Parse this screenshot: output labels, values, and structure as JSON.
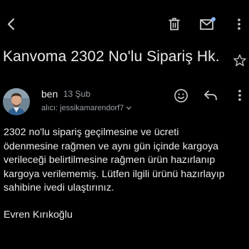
{
  "toolbar": {
    "icons": [
      "back-arrow-icon",
      "trash-icon",
      "mark-unread-icon",
      "more-vert-icon"
    ]
  },
  "email": {
    "subject": "Kanvoma 2302 No'lu Sipariş Hk.",
    "sender_name": "ben",
    "date": "13 Şub",
    "recipient": "alıcı: jessikamarendorf7",
    "body_lines": [
      "2302 no'lu sipariş geçilmesine ve ücreti",
      "ödenmesine rağmen ve aynı gün içinde kargoya",
      "verileceği belirtilmesine rağmen ürün hazırlanıp",
      "kargoya verilememiş. Lütfen ilgili ürünü hazırlayıp",
      "sahibine ivedi ulaştırınız."
    ],
    "signature": "Evren Kırıkoğlu"
  },
  "colors": {
    "background": "#000000",
    "text": "#e8eaed",
    "secondary_text": "#9aa0a6",
    "icon": "#c4c7c5",
    "badge": "#8ab4f8"
  }
}
